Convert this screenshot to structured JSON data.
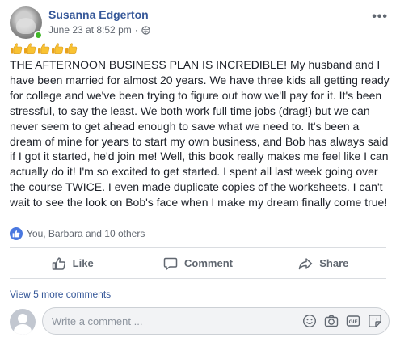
{
  "post": {
    "author": "Susanna Edgerton",
    "timestamp": "June 23 at 8:52 pm",
    "separator": "·",
    "privacy_icon": "globe-icon",
    "more_icon": "more-dots-icon",
    "emoji": [
      "thumbs-up",
      "thumbs-up",
      "thumbs-up",
      "thumbs-up",
      "thumbs-up"
    ],
    "text": "THE AFTERNOON BUSINESS PLAN IS INCREDIBLE! My husband and I have been married for almost 20 years. We have three kids all getting ready for college and we've been trying to figure out how we'll pay for it. It's been stressful, to say the least. We both work full time jobs (drag!) but we can never seem to get ahead enough to save what we need to. It's been a dream of mine for years to start my own business, and Bob has always said if I got it started, he'd join me! Well, this book really makes me feel like I can actually do it! I'm so excited to get started. I spent all last week going over the course TWICE. I even made duplicate copies of the worksheets. I can't wait to see the look on Bob's face when I make my dream finally come true!"
  },
  "reactions": {
    "icon": "like-icon",
    "summary": "You, Barbara and 10 others"
  },
  "actions": {
    "like": "Like",
    "comment": "Comment",
    "share": "Share"
  },
  "comments": {
    "view_more": "View 5 more comments",
    "placeholder": "Write a comment ...",
    "icons": [
      "emoji-icon",
      "camera-icon",
      "gif-icon",
      "sticker-icon"
    ]
  },
  "colors": {
    "link_blue": "#365899",
    "like_blue": "#4a78e0",
    "online_green": "#42b72a",
    "muted_text": "#616770",
    "divider": "#dadde1"
  }
}
